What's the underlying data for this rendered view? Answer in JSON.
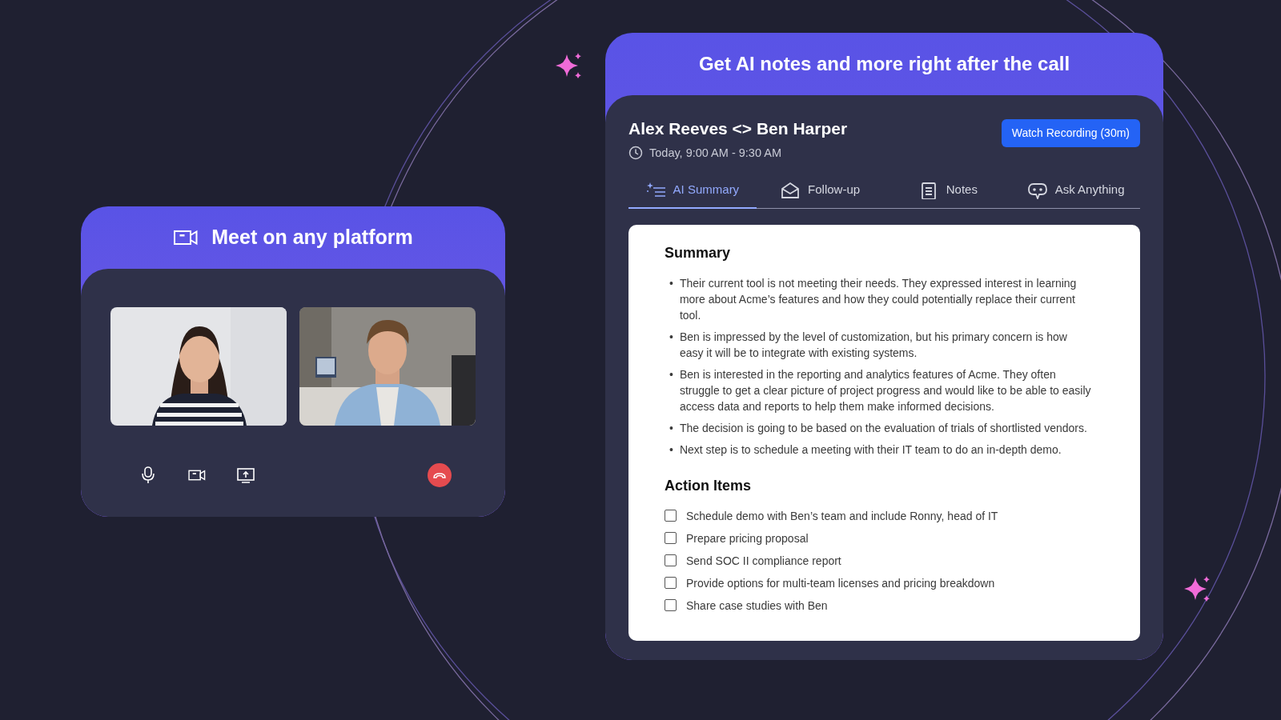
{
  "meeting_card": {
    "title": "Meet on any platform"
  },
  "notes_card": {
    "banner": "Get AI notes and more right after the call",
    "meeting_title": "Alex Reeves <> Ben Harper",
    "time": "Today, 9:00 AM - 9:30 AM",
    "watch_button": "Watch Recording (30m)",
    "tabs": [
      {
        "label": "AI Summary",
        "selected": true
      },
      {
        "label": "Follow-up",
        "selected": false
      },
      {
        "label": "Notes",
        "selected": false
      },
      {
        "label": "Ask Anything",
        "selected": false
      }
    ],
    "summary": {
      "heading": "Summary",
      "bullets": [
        {
          "marker": "•",
          "text": "Their current tool is not meeting their needs. They expressed interest in learning more about Acme’s features and how they could potentially replace their current tool."
        },
        {
          "marker": "•",
          "text": "Ben is impressed by the level of customization, but his primary concern is how easy it will be to integrate with existing systems."
        },
        {
          "marker": "•",
          "text": "Ben is interested in the reporting and analytics features of Acme. They often struggle to get a clear picture of project progress and would like to be able to easily access data and reports to help them make informed decisions."
        },
        {
          "marker": "•",
          "text": "The decision is going to be based on the evaluation of trials of shortlisted vendors."
        },
        {
          "marker": "•",
          "text": "Next step is to schedule a meeting with their IT team to do an in-depth demo."
        }
      ]
    },
    "action_items": {
      "heading": "Action Items",
      "items": [
        {
          "text": "Schedule demo with Ben’s team and include Ronny, head of IT",
          "checked": false
        },
        {
          "text": "Prepare pricing proposal",
          "checked": false
        },
        {
          "text": "Send SOC II compliance report",
          "checked": false
        },
        {
          "text": "Provide options for multi-team licenses and pricing breakdown",
          "checked": false
        },
        {
          "text": "Share case studies with Ben",
          "checked": false
        }
      ]
    }
  }
}
